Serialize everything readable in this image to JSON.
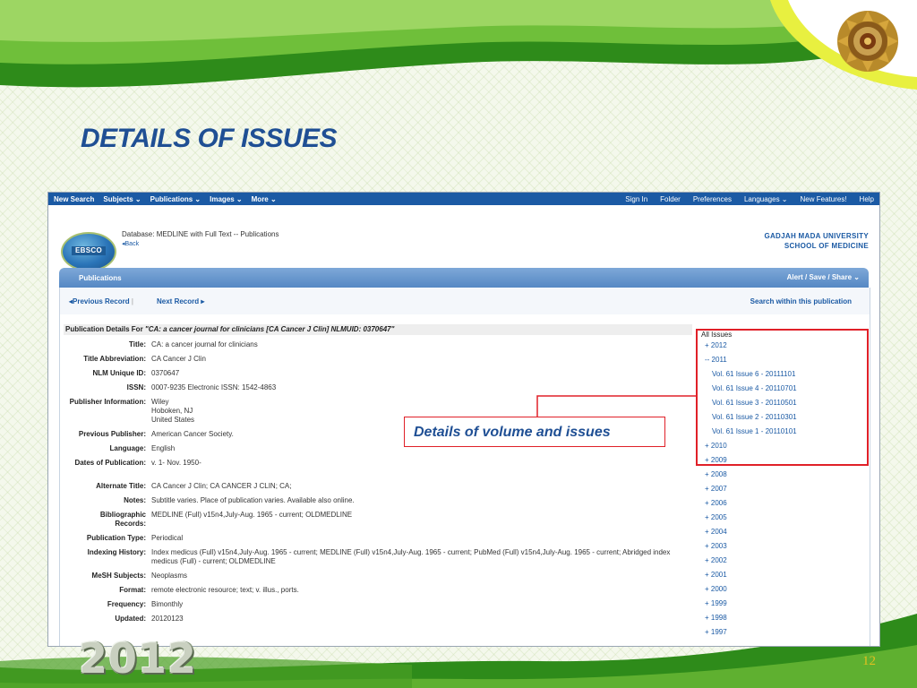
{
  "slide": {
    "title": "DETAILS OF ISSUES",
    "page_number": "12",
    "year": "2012",
    "callout": "Details of volume and issues"
  },
  "topbar": {
    "left": [
      "New Search",
      "Subjects ⌄",
      "Publications ⌄",
      "Images ⌄",
      "More ⌄"
    ],
    "right": [
      "Sign In",
      "Folder",
      "Preferences",
      "Languages ⌄",
      "New Features!",
      "Help"
    ]
  },
  "header": {
    "logo": "EBSCO",
    "database": "Database: MEDLINE with Full Text -- Publications",
    "back": "Back",
    "university_line1": "GADJAH MADA UNIVERSITY",
    "university_line2": "SCHOOL OF MEDICINE"
  },
  "publications_bar": {
    "title": "Publications",
    "actions": "Alert / Save / Share"
  },
  "nav": {
    "previous": "Previous Record",
    "next": "Next Record",
    "search_within": "Search within this publication"
  },
  "details": {
    "heading_prefix": "Publication Details For",
    "heading_title": "\"CA: a cancer journal for clinicians [CA Cancer J Clin] NLMUID: 0370647\"",
    "fields": [
      {
        "label": "Title:",
        "value": "CA: a cancer journal for clinicians"
      },
      {
        "label": "Title Abbreviation:",
        "value": "CA Cancer J Clin"
      },
      {
        "label": "NLM Unique ID:",
        "value": "0370647"
      },
      {
        "label": "ISSN:",
        "value": "0007-9235 Electronic ISSN: 1542-4863"
      },
      {
        "label": "Publisher Information:",
        "value": "Wiley\nHoboken, NJ\nUnited States"
      },
      {
        "label": "Previous Publisher:",
        "value": "American Cancer Society."
      },
      {
        "label": "Language:",
        "value": "English"
      },
      {
        "label": "Dates of Publication:",
        "value": "v. 1- Nov. 1950-"
      },
      {
        "label": "Alternate Title:",
        "value": "CA Cancer J Clin; CA CANCER J CLIN; CA;"
      },
      {
        "label": "Notes:",
        "value": "Subtitle varies. Place of publication varies. Available also online."
      },
      {
        "label": "Bibliographic Records:",
        "value": "MEDLINE (Full) v15n4,July-Aug. 1965 - current; OLDMEDLINE"
      },
      {
        "label": "Publication Type:",
        "value": "Periodical"
      },
      {
        "label": "Indexing History:",
        "value": "Index medicus (Full) v15n4,July-Aug. 1965 - current; MEDLINE (Full) v15n4,July-Aug. 1965 - current; PubMed (Full) v15n4,July-Aug. 1965 - current; Abridged index medicus (Full) - current; OLDMEDLINE"
      },
      {
        "label": "MeSH Subjects:",
        "value": "Neoplasms"
      },
      {
        "label": "Format:",
        "value": "remote electronic resource; text; v. illus., ports."
      },
      {
        "label": "Frequency:",
        "value": "Bimonthly"
      },
      {
        "label": "Updated:",
        "value": "20120123"
      }
    ]
  },
  "issues": {
    "header": "All Issues",
    "items": [
      "+ 2012",
      "-- 2011",
      "Vol. 61 Issue 6 - 20111101",
      "Vol. 61 Issue 4 - 20110701",
      "Vol. 61 Issue 3 - 20110501",
      "Vol. 61 Issue 2 - 20110301",
      "Vol. 61 Issue 1 - 20110101",
      "+ 2010",
      "+ 2009",
      "+ 2008",
      "+ 2007",
      "+ 2006",
      "+ 2005",
      "+ 2004",
      "+ 2003",
      "+ 2002",
      "+ 2001",
      "+ 2000",
      "+ 1999",
      "+ 1998",
      "+ 1997"
    ]
  },
  "colors": {
    "title": "#1f4f94",
    "accent_green": "#2e8b1a",
    "highlight_red": "#e02028",
    "ebsco_blue": "#1b5aa4"
  }
}
